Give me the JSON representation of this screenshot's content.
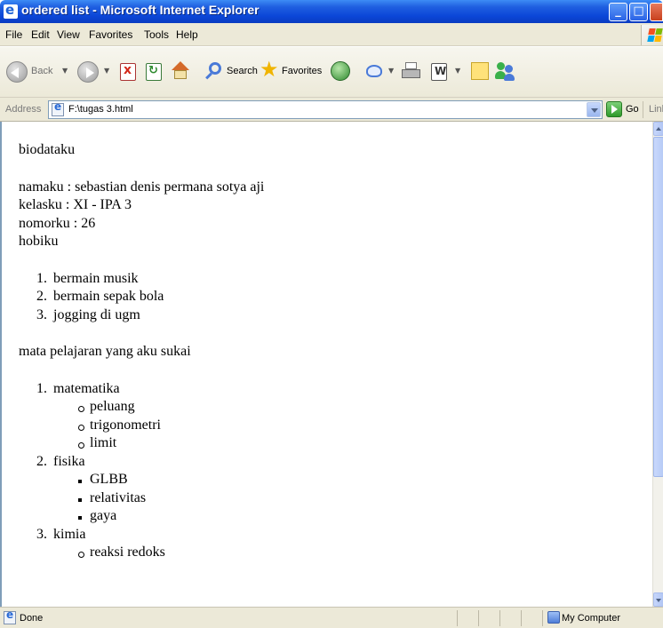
{
  "window": {
    "title": "ordered list - Microsoft Internet Explorer"
  },
  "menu": [
    "File",
    "Edit",
    "View",
    "Favorites",
    "Tools",
    "Help"
  ],
  "toolbar": {
    "back_label": "Back",
    "search_label": "Search",
    "favorites_label": "Favorites",
    "icons": [
      "back-arrow-icon",
      "forward-arrow-icon",
      "stop-icon",
      "refresh-icon",
      "home-icon",
      "search-icon",
      "favorites-star-icon",
      "history-icon",
      "mail-icon",
      "print-icon",
      "edit-icon",
      "notes-icon",
      "messenger-icon"
    ]
  },
  "address": {
    "label": "Address",
    "value": "F:\\tugas 3.html",
    "go_label": "Go",
    "links_label": "Links"
  },
  "content": {
    "heading": "biodataku",
    "info": [
      "namaku : sebastian denis permana sotya aji",
      "kelasku : XI - IPA 3",
      "nomorku : 26",
      "hobiku"
    ],
    "hobbies": [
      "bermain musik",
      "bermain sepak bola",
      "jogging di ugm"
    ],
    "subjects_heading": "mata pelajaran yang aku sukai",
    "subjects": [
      {
        "name": "matematika",
        "items": [
          "peluang",
          "trigonometri",
          "limit"
        ]
      },
      {
        "name": "fisika",
        "items": [
          "GLBB",
          "relativitas",
          "gaya"
        ]
      },
      {
        "name": "kimia",
        "items": [
          "reaksi redoks"
        ]
      }
    ]
  },
  "status": {
    "text": "Done",
    "zone": "My Computer"
  }
}
